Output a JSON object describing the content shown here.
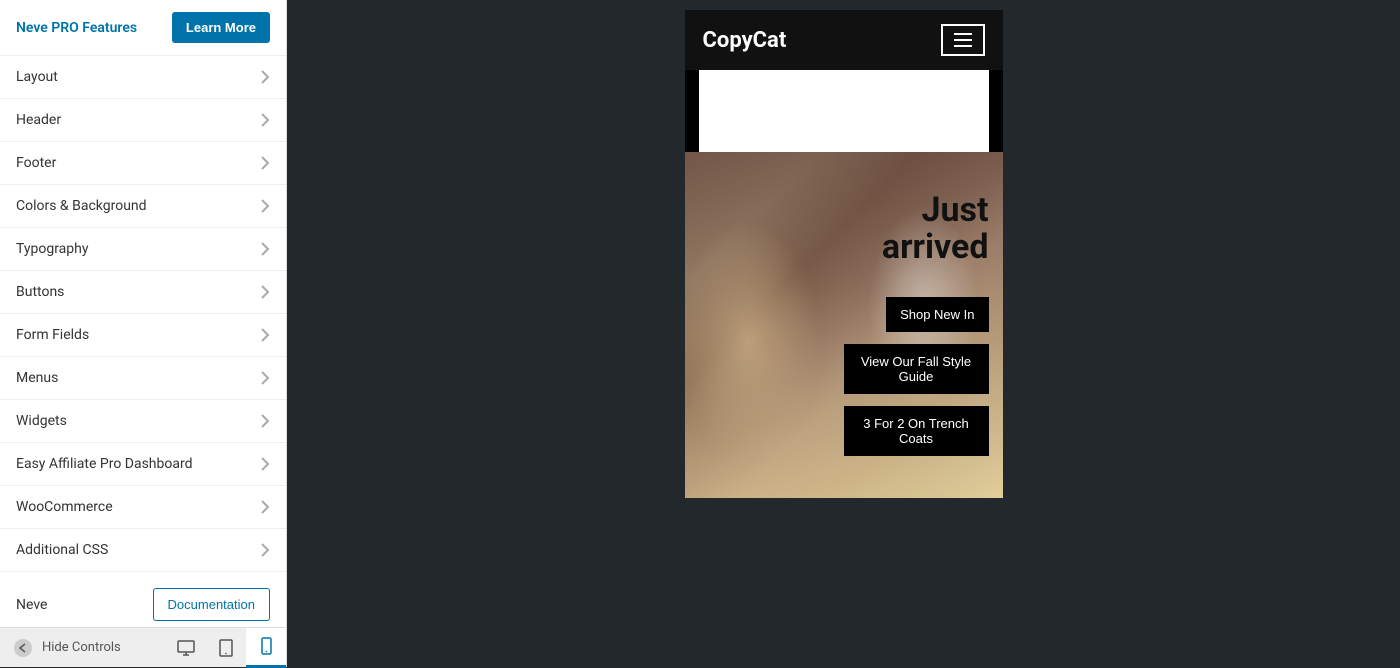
{
  "sidebar": {
    "pro_title": "Neve PRO Features",
    "learn_more": "Learn More",
    "panels": [
      "Layout",
      "Header",
      "Footer",
      "Colors & Background",
      "Typography",
      "Buttons",
      "Form Fields",
      "Menus",
      "Widgets",
      "Easy Affiliate Pro Dashboard",
      "WooCommerce",
      "Additional CSS"
    ],
    "neve_label": "Neve",
    "doc_button": "Documentation",
    "hide_controls": "Hide Controls"
  },
  "preview": {
    "site_title": "CopyCat",
    "hero_title": "Just arrived",
    "buttons": [
      "Shop New In",
      "View Our Fall Style Guide",
      "3 For 2 On Trench Coats"
    ]
  },
  "colors": {
    "accent": "#0073aa",
    "preview_bg": "#23282d"
  }
}
